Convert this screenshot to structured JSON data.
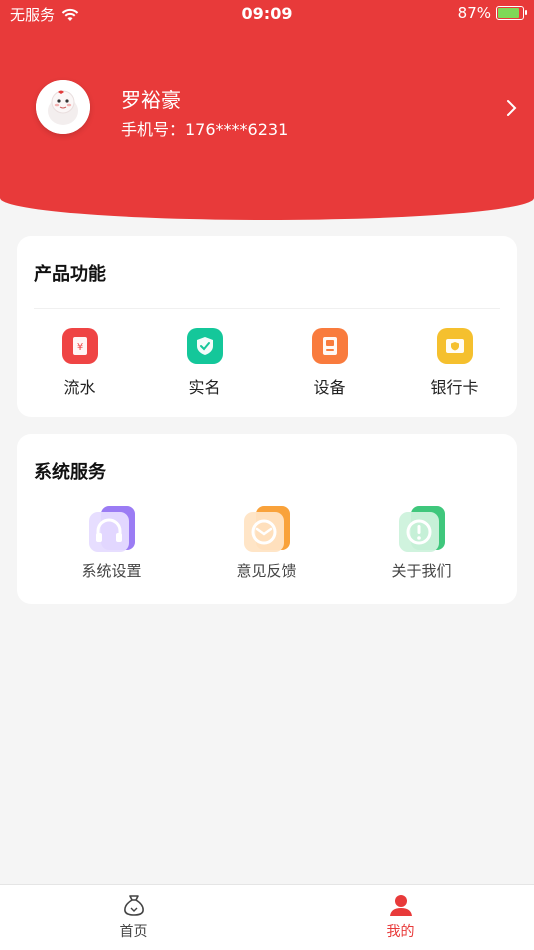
{
  "colors": {
    "brand_red": "#e83a3a",
    "page_bg": "#f5f5f5",
    "battery_green": "#7ed957"
  },
  "status_bar": {
    "carrier": "无服务",
    "time": "09:09",
    "battery_percent": "87%",
    "battery_level": 0.87,
    "icons": [
      "wifi-icon",
      "battery-charging-icon"
    ]
  },
  "profile": {
    "name": "罗裕豪",
    "phone_label": "手机号：176****6231",
    "icons": [
      "avatar",
      "chevron-right-icon"
    ]
  },
  "product_section": {
    "title": "产品功能",
    "items": [
      {
        "label": "流水",
        "icon": "yuan-receipt-icon",
        "color": "#ef4444"
      },
      {
        "label": "实名",
        "icon": "shield-check-icon",
        "color": "#14c79a"
      },
      {
        "label": "设备",
        "icon": "device-icon",
        "color": "#f97b3d"
      },
      {
        "label": "银行卡",
        "icon": "bank-card-icon",
        "color": "#f5c02e"
      }
    ]
  },
  "service_section": {
    "title": "系统服务",
    "items": [
      {
        "label": "系统设置",
        "icon": "headphones-icon",
        "color": "#9b7cf4"
      },
      {
        "label": "意见反馈",
        "icon": "mail-icon",
        "color": "#f9a23b"
      },
      {
        "label": "关于我们",
        "icon": "info-icon",
        "color": "#3fc77c"
      }
    ]
  },
  "tabbar": {
    "tabs": [
      {
        "label": "首页",
        "icon": "money-bag-icon",
        "active": false
      },
      {
        "label": "我的",
        "icon": "user-icon",
        "active": true
      }
    ]
  }
}
